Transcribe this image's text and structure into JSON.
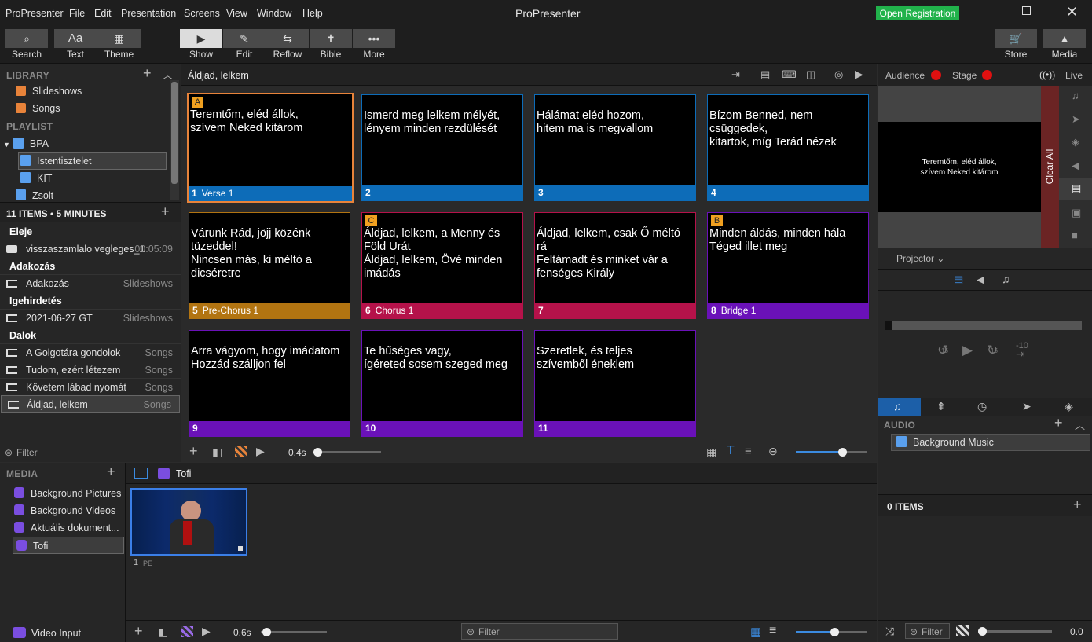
{
  "menu": {
    "items": [
      "ProPresenter",
      "File",
      "Edit",
      "Presentation",
      "Screens",
      "View",
      "Window",
      "Help"
    ],
    "title": "ProPresenter",
    "open_registration": "Open Registration"
  },
  "toolbar": {
    "search": "Search",
    "text": "Text",
    "theme": "Theme",
    "show": "Show",
    "edit": "Edit",
    "reflow": "Reflow",
    "bible": "Bible",
    "more": "More",
    "store": "Store",
    "media": "Media"
  },
  "library": {
    "header": "LIBRARY",
    "items": [
      "Slideshows",
      "Songs"
    ],
    "playlist_header": "PLAYLIST",
    "playlist": {
      "folder": "BPA",
      "items": [
        "Istentisztelet",
        "KIT",
        "Zsolt"
      ]
    }
  },
  "playlist_detail": {
    "summary": "11 ITEMS • 5 MINUTES",
    "sections": [
      {
        "title": "Eleje",
        "rows": [
          {
            "name": "visszaszamlalo vegleges_1",
            "right": "00:05:09"
          }
        ]
      },
      {
        "title": "Adakozás",
        "rows": [
          {
            "name": "Adakozás",
            "right": "Slideshows"
          }
        ]
      },
      {
        "title": "Igehirdetés",
        "rows": [
          {
            "name": "2021-06-27 GT",
            "right": "Slideshows"
          }
        ]
      },
      {
        "title": "Dalok",
        "rows": [
          {
            "name": "A Golgotára gondolok",
            "right": "Songs"
          },
          {
            "name": "Tudom, ezért létezem",
            "right": "Songs"
          },
          {
            "name": "Követem lábad nyomát",
            "right": "Songs"
          },
          {
            "name": "Áldjad, lelkem",
            "right": "Songs"
          }
        ]
      }
    ],
    "filter": "Filter"
  },
  "presentation": {
    "title": "Áldjad, lelkem",
    "speed": "0.4s",
    "slides": [
      {
        "num": "1",
        "label": "Verse 1",
        "text": "Teremtőm, eléd állok,\nszívem Neked kitárom",
        "color": "#0d6cb8",
        "badge": "A"
      },
      {
        "num": "2",
        "label": "",
        "text": "Ismerd meg lelkem mélyét,\nlényem minden rezdülését",
        "color": "#0d6cb8",
        "badge": ""
      },
      {
        "num": "3",
        "label": "",
        "text": "Hálámat eléd hozom,\nhitem ma is megvallom",
        "color": "#0d6cb8",
        "badge": ""
      },
      {
        "num": "4",
        "label": "",
        "text": "Bízom Benned, nem\ncsüggedek,\nkitartok, míg Terád nézek",
        "color": "#0d6cb8",
        "badge": ""
      },
      {
        "num": "5",
        "label": "Pre-Chorus 1",
        "text": "Várunk Rád, jöjj közénk\ntüzeddel!\nNincsen más, ki méltó a\ndicséretre",
        "color": "#b27411",
        "badge": ""
      },
      {
        "num": "6",
        "label": "Chorus 1",
        "text": "Áldjad, lelkem, a Menny és\nFöld Urát\nÁldjad, lelkem, Övé minden\nimádás",
        "color": "#b5124a",
        "badge": "C"
      },
      {
        "num": "7",
        "label": "",
        "text": "Áldjad, lelkem, csak Ő méltó\nrá\nFeltámadt és minket vár a\nfenséges Király",
        "color": "#b5124a",
        "badge": ""
      },
      {
        "num": "8",
        "label": "Bridge 1",
        "text": "Minden áldás, minden hála\nTéged illet meg",
        "color": "#6a11b8",
        "badge": "B"
      },
      {
        "num": "9",
        "label": "",
        "text": "Arra vágyom, hogy imádatom\nHozzád szálljon fel",
        "color": "#6a11b8",
        "badge": ""
      },
      {
        "num": "10",
        "label": "",
        "text": "Te hűséges vagy,\nígéreted sosem szeged meg",
        "color": "#6a11b8",
        "badge": ""
      },
      {
        "num": "11",
        "label": "",
        "text": "Szeretlek, és teljes\nszívemből éneklem",
        "color": "#6a11b8",
        "badge": ""
      }
    ]
  },
  "right": {
    "audience": "Audience",
    "stage": "Stage",
    "live": "Live",
    "preview_text": "Teremtőm, eléd állok,\nszívem Neked kitárom",
    "clear_all": "Clear All",
    "projector": "Projector",
    "audio_header": "AUDIO",
    "audio_item": "Background Music",
    "items_count": "0 ITEMS",
    "filter": "Filter",
    "volume": "0.0",
    "back15": "15",
    "fwd15": "15",
    "minus10": "-10"
  },
  "media": {
    "header": "MEDIA",
    "items": [
      "Background Pictures",
      "Background Videos",
      "Aktuális dokument...",
      "Tofi"
    ],
    "video_input": "Video Input",
    "bin_title": "Tofi",
    "thumb_num": "1",
    "thumb_tag": "PE",
    "speed": "0.6s",
    "filter": "Filter"
  }
}
